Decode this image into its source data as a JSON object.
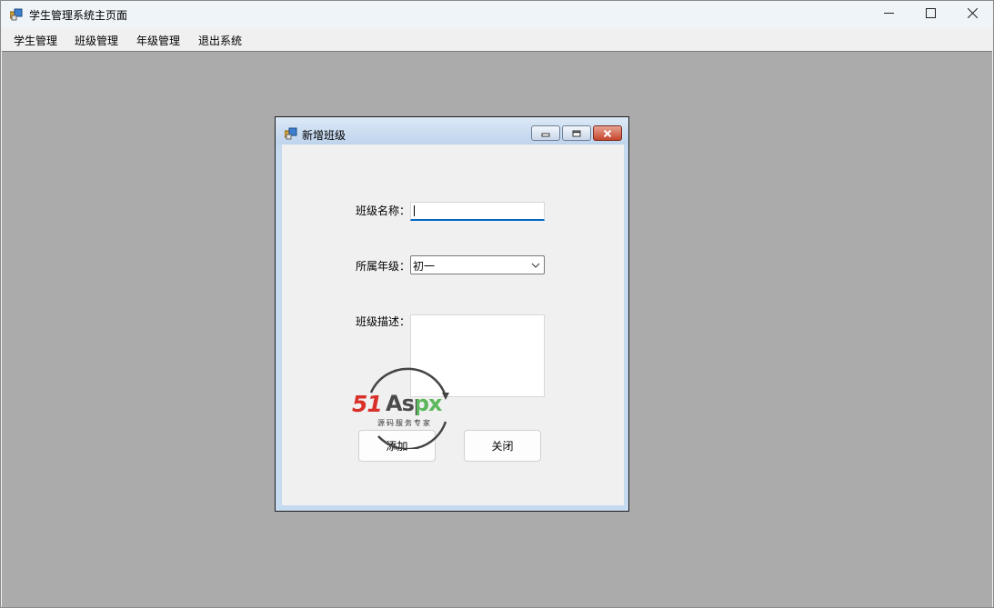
{
  "window": {
    "title": "学生管理系统主页面",
    "icon": "app-icon",
    "controls": {
      "minimize": "minimize-icon",
      "maximize": "maximize-icon",
      "close": "close-icon"
    }
  },
  "menu": [
    {
      "label": "学生管理"
    },
    {
      "label": "班级管理"
    },
    {
      "label": "年级管理"
    },
    {
      "label": "退出系统"
    }
  ],
  "dialog": {
    "title": "新增班级",
    "icon": "app-icon",
    "fields": {
      "class_name": {
        "label": "班级名称：",
        "value": ""
      },
      "grade": {
        "label": "所属年级：",
        "selected": "初一"
      },
      "description": {
        "label": "班级描述：",
        "value": ""
      }
    },
    "buttons": {
      "add": "添加",
      "close": "关闭"
    }
  },
  "watermark": {
    "brand_a": "51",
    "brand_b": "Aspx",
    "tagline": "源码服务专家"
  },
  "colors": {
    "mdi_background": "#ababab",
    "accent": "#0067c0",
    "dialog_frame": "#c6daf0",
    "close_button": "#c4452b",
    "watermark_red": "#d9302a",
    "watermark_green": "#5cb85c"
  }
}
